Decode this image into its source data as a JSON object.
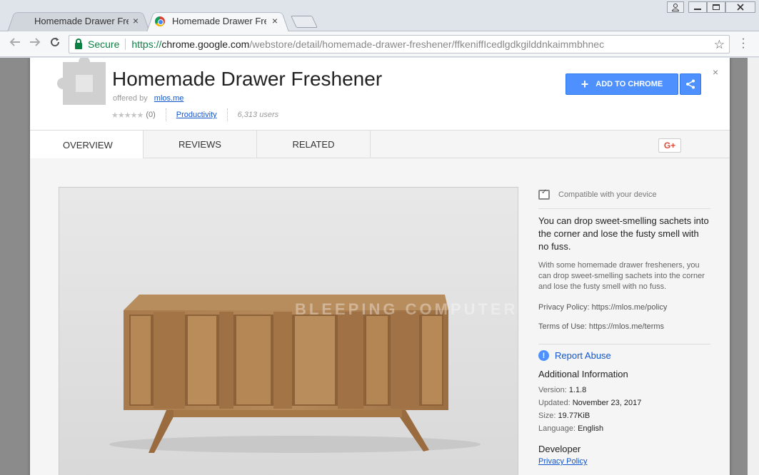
{
  "browser": {
    "tabs": [
      {
        "label": "Homemade Drawer Fresh",
        "close": "×"
      },
      {
        "label": "Homemade Drawer Fresh",
        "close": "×"
      }
    ],
    "secure_label": "Secure",
    "url_scheme": "https://",
    "url_host": "chrome.google.com",
    "url_path": "/webstore/detail/homemade-drawer-freshener/ffkeniffIcedlgdkgilddnkaimmbhnec"
  },
  "extension": {
    "title": "Homemade Drawer Freshener",
    "offered_by_label": "offered by",
    "offered_by": "mlos.me",
    "rating_count": "(0)",
    "category": "Productivity",
    "users": "6,313 users",
    "add_button": "ADD TO CHROME",
    "close": "×"
  },
  "page_tabs": [
    "OVERVIEW",
    "REVIEWS",
    "RELATED"
  ],
  "gplus": "G+",
  "sidebar": {
    "compatible": "Compatible with your device",
    "description_main": "You can drop sweet-smelling sachets into the corner and lose the fusty smell with no fuss.",
    "description_small": "With some homemade drawer fresheners, you can drop sweet-smelling sachets into the corner and lose the fusty smell with no fuss.",
    "privacy_policy": "Privacy Policy: https://mlos.me/policy",
    "terms": "Terms of Use: https://mlos.me/terms",
    "report_abuse": "Report Abuse",
    "additional_info_title": "Additional Information",
    "version_label": "Version:",
    "version": "1.1.8",
    "updated_label": "Updated:",
    "updated": "November 23, 2017",
    "size_label": "Size:",
    "size": "19.77KiB",
    "language_label": "Language:",
    "language": "English",
    "developer_title": "Developer",
    "developer_link": "Privacy Policy"
  },
  "watermark": "BLEEPING COMPUTER",
  "colors": {
    "accent": "#4d90fe",
    "link": "#1155cc",
    "secure": "#0b8043"
  }
}
